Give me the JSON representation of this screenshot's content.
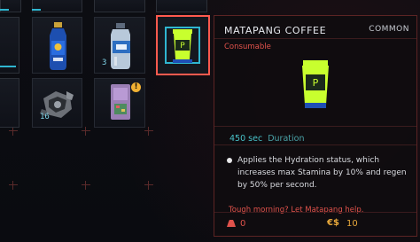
{
  "inventory": {
    "slots": [
      {
        "item_icon": "energy-drink-bottle-icon",
        "qty": ""
      },
      {
        "item_icon": "water-bottle-icon",
        "qty": "3"
      },
      {
        "item_icon": "coffee-cup-icon",
        "qty": ""
      },
      {
        "item_icon": "cyberware-scrap-icon",
        "qty": "16"
      },
      {
        "item_icon": "circuit-chip-icon",
        "qty": "",
        "badge": "!"
      }
    ]
  },
  "tooltip": {
    "title": "MATAPANG COFFEE",
    "rarity": "COMMON",
    "type": "Consumable",
    "item_icon": "coffee-cup-icon",
    "duration_value": "450 sec",
    "duration_label": "Duration",
    "effect": "Applies the Hydration status, which increases max Stamina by 10% and regen by 50% per second.",
    "flavor": "Tough morning? Let Matapang help.",
    "weight_icon": "weight-icon",
    "weight": "0",
    "money_icon": "eurodollar-icon",
    "money_symbol": "€$",
    "price": "10"
  },
  "colors": {
    "accent_red": "#ff5a4e",
    "cyan": "#2fb6d0",
    "gold": "#e7a83b",
    "cup_green": "#c8ff2e"
  }
}
